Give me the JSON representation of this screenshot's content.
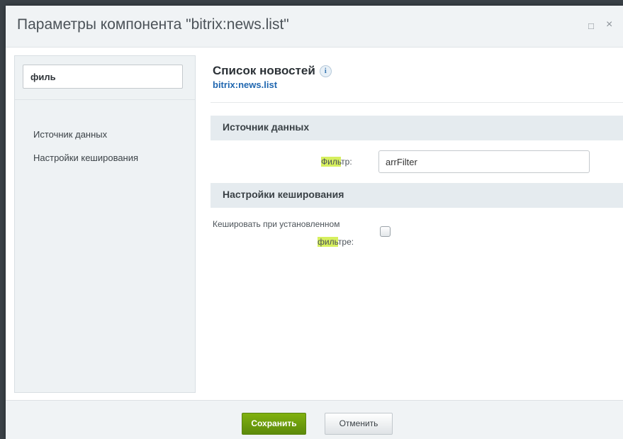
{
  "dialog": {
    "title": "Параметры компонента \"bitrix:news.list\"",
    "maximize_glyph": "□",
    "close_glyph": "×"
  },
  "sidebar": {
    "search": {
      "value": "филь",
      "placeholder": ""
    },
    "items": [
      {
        "label": "Источник данных"
      },
      {
        "label": "Настройки кеширования"
      }
    ]
  },
  "component": {
    "name": "Список новостей",
    "code": "bitrix:news.list",
    "info_glyph": "i"
  },
  "sections": [
    {
      "title": "Источник данных",
      "field": {
        "label_highlight": "Филь",
        "label_rest": "тр:",
        "value": "arrFilter"
      }
    },
    {
      "title": "Настройки кеширования",
      "field": {
        "label_line1": "Кешировать при установленном",
        "label_highlight": "филь",
        "label_rest": "тре:",
        "checked": false
      }
    }
  ],
  "footer": {
    "save_label": "Сохранить",
    "cancel_label": "Отменить"
  },
  "colors": {
    "highlight": "#d6ef5e",
    "save_button": "#6f9e0d",
    "link": "#2067b0"
  }
}
